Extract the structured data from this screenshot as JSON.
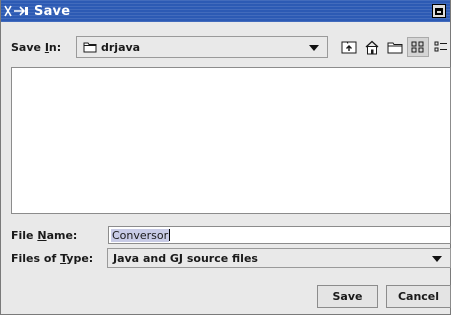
{
  "window": {
    "title": "Save",
    "titlebar_color": "#2c5ab4"
  },
  "save_in": {
    "label_pre": "Save ",
    "label_mnemonic": "I",
    "label_post": "n:",
    "value": "drjava",
    "icon": "folder-icon"
  },
  "toolbar": {
    "up_icon": "up-folder-icon",
    "home_icon": "home-icon",
    "new_folder_icon": "new-folder-icon",
    "list_view_icon": "list-view-icon",
    "details_view_icon": "details-view-icon"
  },
  "file_list": {
    "items": []
  },
  "file_name": {
    "label_pre": "File ",
    "label_mnemonic": "N",
    "label_post": "ame:",
    "value": "Conversor"
  },
  "files_of_type": {
    "label_pre": "Files of ",
    "label_mnemonic": "T",
    "label_post": "ype:",
    "value": "Java and GJ source files"
  },
  "buttons": {
    "save": "Save",
    "cancel": "Cancel"
  }
}
